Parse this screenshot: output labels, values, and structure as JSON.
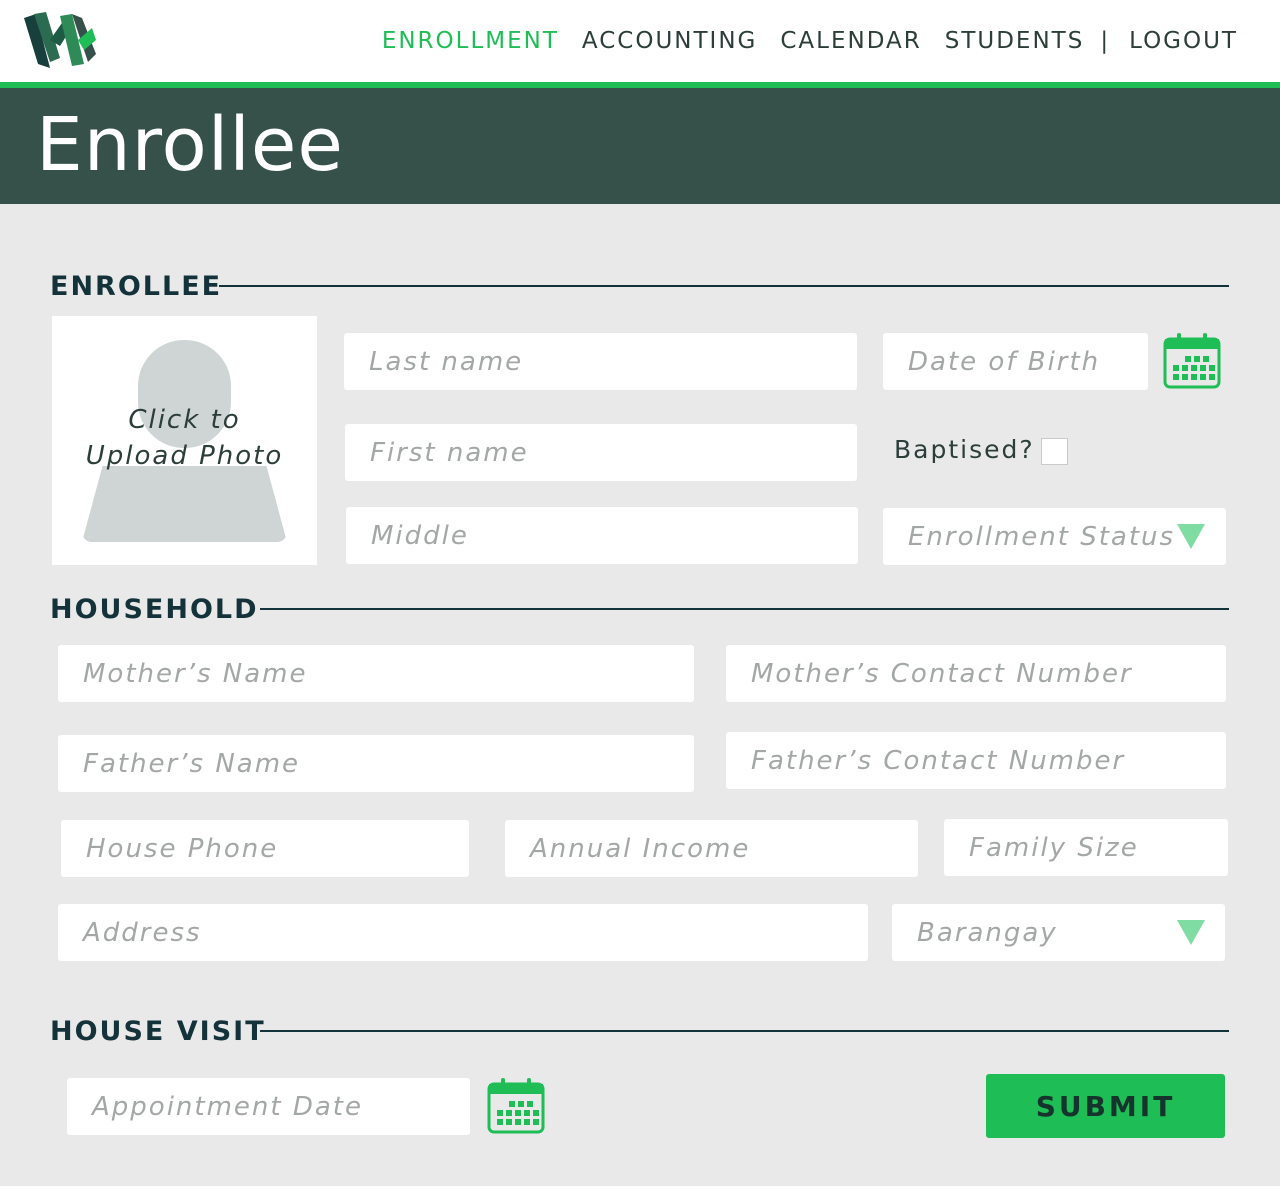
{
  "nav": {
    "items": [
      "ENROLLMENT",
      "ACCOUNTING",
      "CALENDAR",
      "STUDENTS"
    ],
    "active": "ENROLLMENT",
    "separator": "|",
    "logout": "LOGOUT",
    "logo_icon": "school-logo-icon"
  },
  "page": {
    "title": "Enrollee"
  },
  "sections": {
    "enrollee": "ENROLLEE",
    "household": "HOUSEHOLD",
    "house_visit": "HOUSE VISIT"
  },
  "enrollee": {
    "photo_label_line1": "Click to",
    "photo_label_line2": "Upload Photo",
    "last_name": "Last name",
    "first_name": "First name",
    "middle": "Middle",
    "date_of_birth": "Date of Birth",
    "baptised_label": "Baptised?",
    "baptised_checked": false,
    "enrollment_status": "Enrollment Status"
  },
  "household": {
    "mothers_name": "Mother’s Name",
    "mothers_contact": "Mother’s Contact Number",
    "fathers_name": "Father’s Name",
    "fathers_contact": "Father’s Contact Number",
    "house_phone": "House Phone",
    "annual_income": "Annual Income",
    "family_size": "Family Size",
    "address": "Address",
    "barangay": "Barangay"
  },
  "house_visit": {
    "appointment_date": "Appointment Date",
    "submit": "SUBMIT"
  },
  "colors": {
    "accent_green": "#1fbd55",
    "banner": "#35514a",
    "heading": "#14323a",
    "dropdown_arrow": "#7fdca3",
    "background": "#e9e9e9"
  }
}
